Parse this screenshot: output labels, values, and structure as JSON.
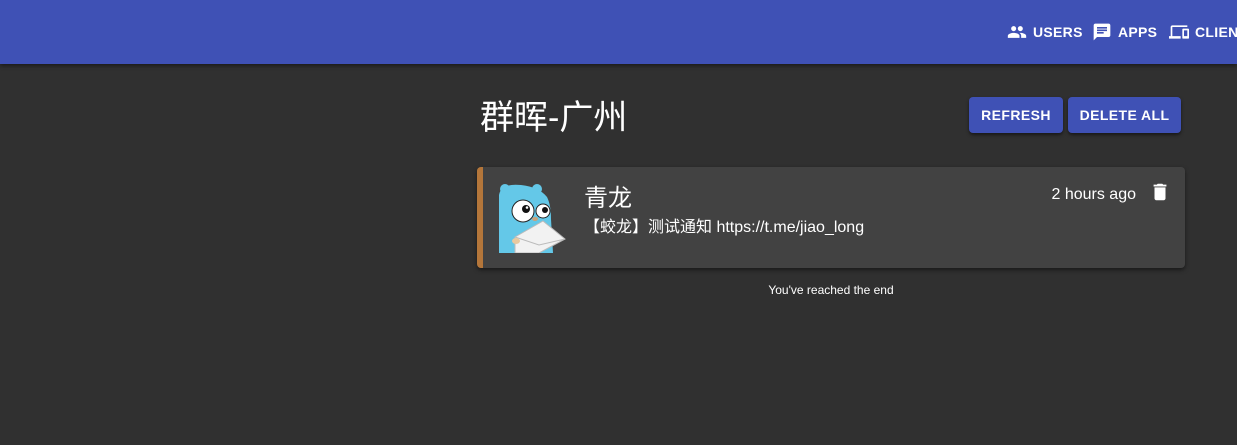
{
  "nav": {
    "users": {
      "label": "USERS",
      "icon": "users-icon"
    },
    "apps": {
      "label": "APPS",
      "icon": "chat-icon"
    },
    "clients": {
      "label": "CLIEN",
      "icon": "devices-icon"
    }
  },
  "colors": {
    "primary": "#3f51b5",
    "background": "#303030",
    "card": "#424242",
    "priority_bar": "#b4763a"
  },
  "page": {
    "title": "群晖-广州",
    "refresh_label": "Refresh",
    "delete_all_label": "Delete All"
  },
  "messages": [
    {
      "title": "青龙",
      "body": "【蛟龙】测试通知 https://t.me/jiao_long",
      "time": "2 hours ago",
      "image": "gopher-avatar",
      "delete_icon": "trash-icon"
    }
  ],
  "end_note": "You've reached the end"
}
